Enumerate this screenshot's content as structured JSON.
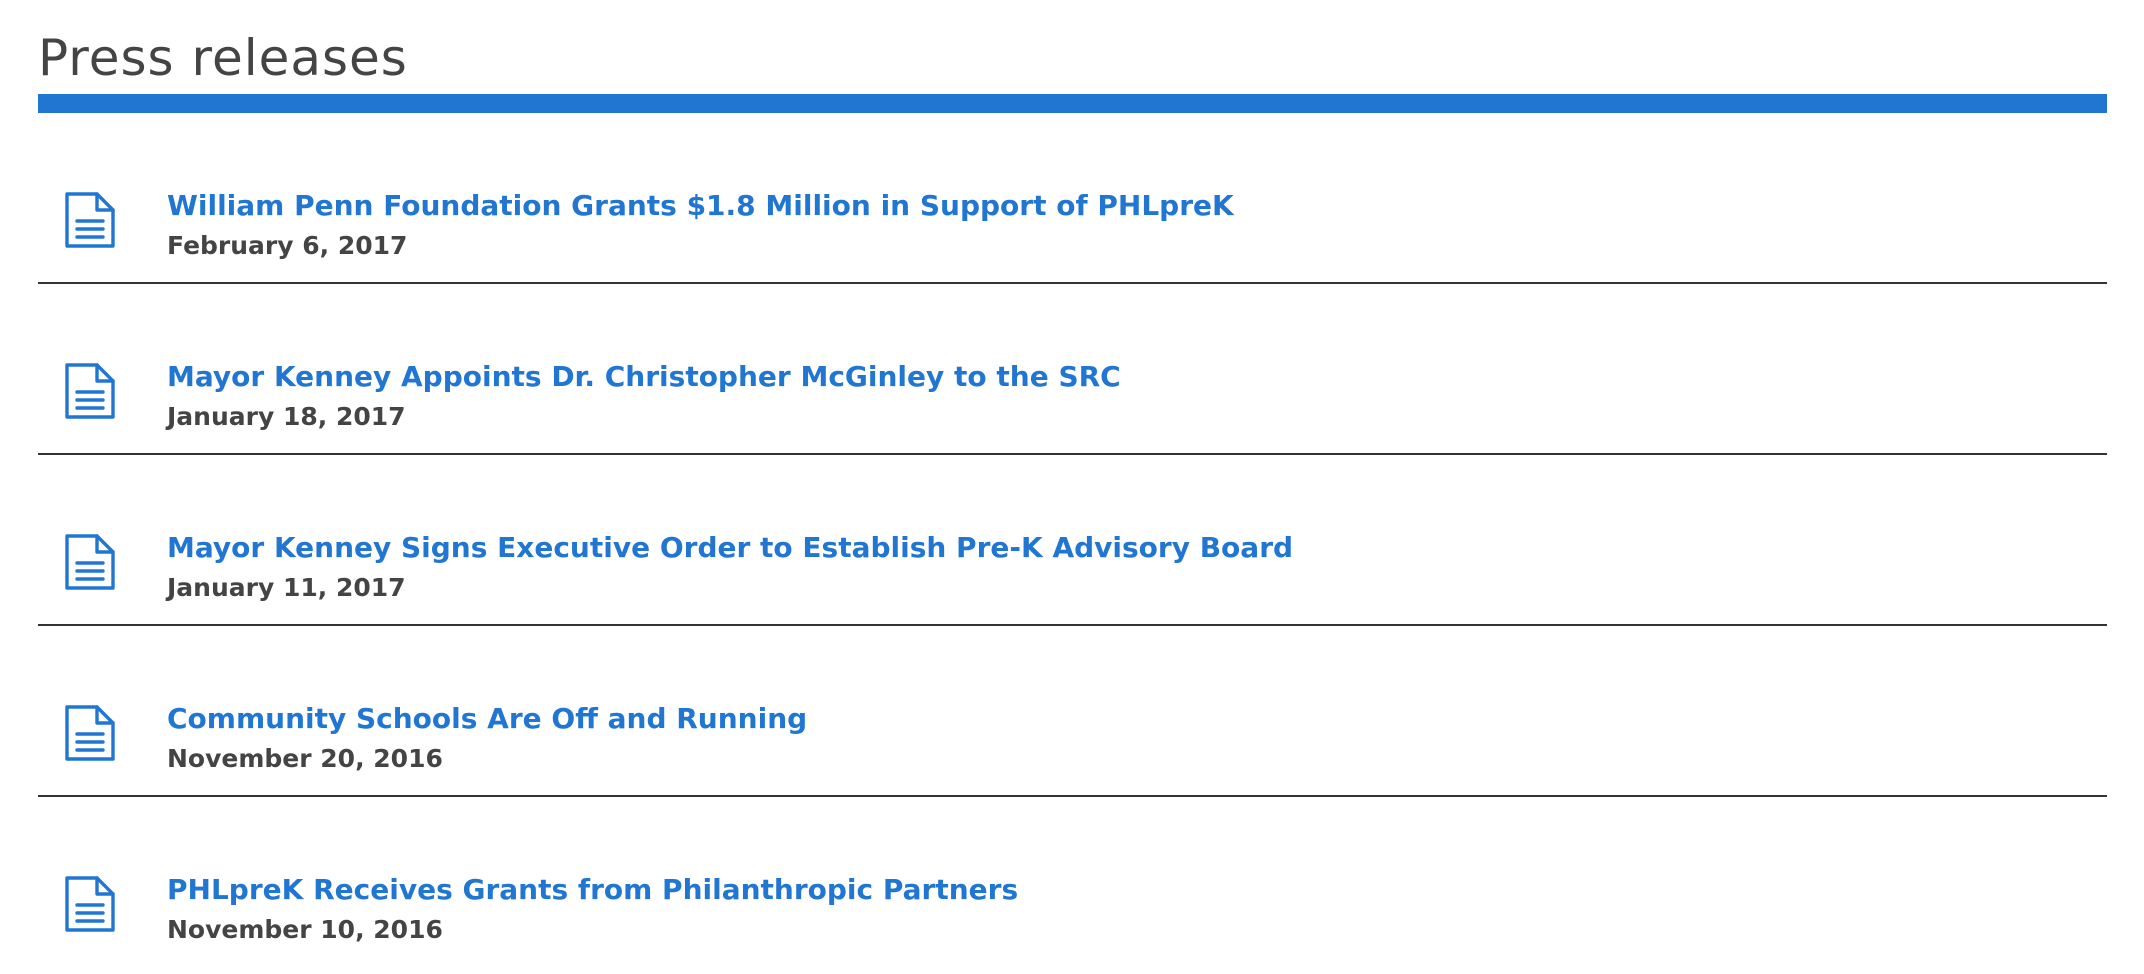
{
  "page": {
    "title": "Press releases",
    "accent_color": "#2176d2",
    "text_color": "#444444"
  },
  "releases": [
    {
      "icon": "document-icon",
      "title": "William Penn Foundation Grants $1.8 Million in Support of PHLpreK",
      "date": "February 6, 2017"
    },
    {
      "icon": "document-icon",
      "title": "Mayor Kenney Appoints Dr. Christopher McGinley to the SRC",
      "date": "January 18, 2017"
    },
    {
      "icon": "document-icon",
      "title": "Mayor Kenney Signs Executive Order to Establish Pre-K Advisory Board",
      "date": "January 11, 2017"
    },
    {
      "icon": "document-icon",
      "title": "Community Schools Are Off and Running",
      "date": "November 20, 2016"
    },
    {
      "icon": "document-icon",
      "title": "PHLpreK Receives Grants from Philanthropic Partners",
      "date": "November 10, 2016"
    }
  ]
}
